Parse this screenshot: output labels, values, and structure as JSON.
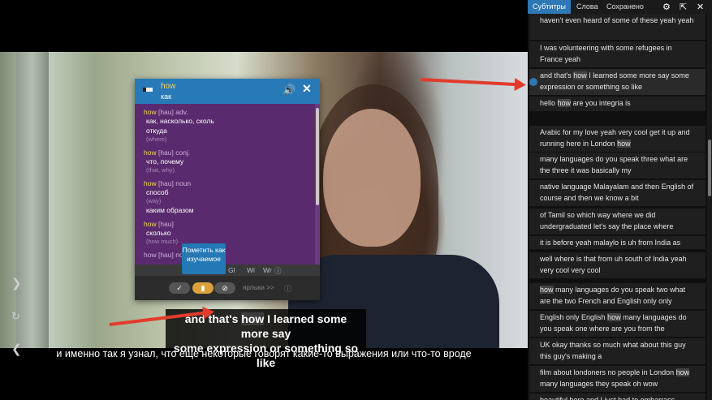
{
  "video": {
    "en_subtitle_line1_before": "and that's ",
    "en_subtitle_word": "how",
    "en_subtitle_line1_after": " I learned some more say",
    "en_subtitle_line2": "some expression or something so like",
    "ru_subtitle": "и именно так я узнал, что еще некоторые говорят какие-то выражения или что-то вроде"
  },
  "dictionary": {
    "word": "how",
    "translation": "как",
    "entries": [
      {
        "head": "how",
        "pos": "[hau] adv.",
        "lines": [
          {
            "m": "как, насколько, сколь"
          },
          {
            "m": "откуда"
          },
          {
            "g": "(where)"
          }
        ]
      },
      {
        "head": "how",
        "pos": "[hau] conj.",
        "lines": [
          {
            "m": "что, почему"
          },
          {
            "g": "(that, why)"
          }
        ]
      },
      {
        "head": "how",
        "pos": "[hau] noun",
        "lines": [
          {
            "m": "способ"
          },
          {
            "g": "(way)"
          },
          {
            "m": "каким образом"
          }
        ]
      },
      {
        "head": "how",
        "pos": "[hau]",
        "lines": [
          {
            "m": "сколько"
          },
          {
            "g": "(how much)"
          }
        ]
      }
    ],
    "partial_next": "how [hau] no",
    "tabs": [
      "Gl",
      "Wi",
      "Wr"
    ],
    "labels_text": "ярлыки >>",
    "tooltip": "Пометить как изучаемое"
  },
  "panel": {
    "tabs": [
      "Субтитры",
      "Слова",
      "Сохранено"
    ],
    "active_tab": "Субтитры",
    "items": [
      {
        "before": "haven't even heard of some of these yeah yeah",
        "hl": "",
        "after": ""
      },
      {
        "before": "I was volunteering with some refugees in France yeah",
        "hl": "",
        "after": ""
      },
      {
        "before": "and that's ",
        "hl": "how",
        "after": " I learned some more say some expression or something so like"
      },
      {
        "before": "hello ",
        "hl": "how",
        "after": " are you integria is"
      },
      {
        "before": "Arabic for my love yeah very cool get it up and running here in London ",
        "hl": "how",
        "after": ""
      },
      {
        "before": "many languages do you speak three what are the three it was basically my",
        "hl": "",
        "after": ""
      },
      {
        "before": "native language Malayalam and then English of course and then we know a bit",
        "hl": "",
        "after": ""
      },
      {
        "before": "of Tamil so which way where we did undergraduated let's say the place where",
        "hl": "",
        "after": ""
      },
      {
        "before": "it is before yeah malaylo is uh from India as",
        "hl": "",
        "after": ""
      },
      {
        "before": "well where is that from uh south of India yeah very cool very cool",
        "hl": "",
        "after": ""
      },
      {
        "before": "",
        "hl": "how",
        "after": " many languages do you speak two what are the two French and English only only"
      },
      {
        "before": "English only English ",
        "hl": "how",
        "after": " many languages do you speak one where are you from the"
      },
      {
        "before": "UK okay thanks so much what about this guy this guy's making a",
        "hl": "",
        "after": ""
      },
      {
        "before": "film about londoners no people in London ",
        "hl": "how",
        "after": " many languages they speak oh wow"
      },
      {
        "before": "beautiful here and I just had to embarrass",
        "hl": "",
        "after": ""
      }
    ]
  },
  "colors": {
    "accent": "#2e78b5",
    "arrow": "#e23b2d",
    "highlight_word": "#f2d94a"
  }
}
